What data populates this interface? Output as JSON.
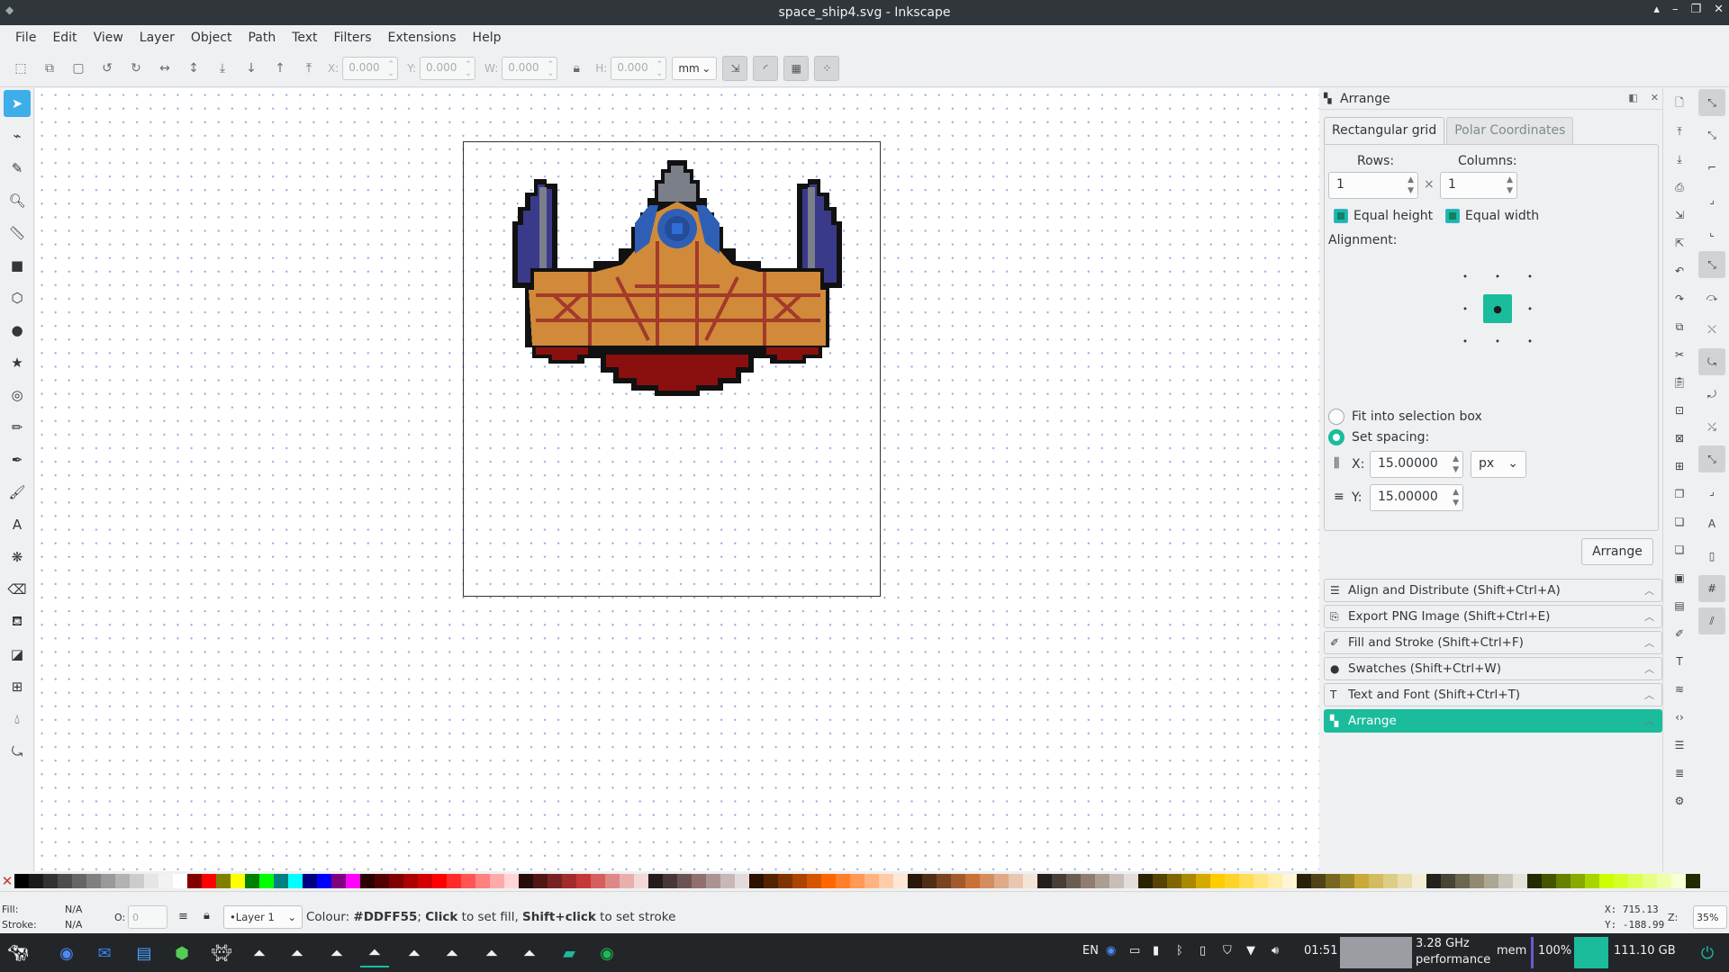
{
  "window": {
    "title": "space_ship4.svg - Inkscape",
    "buttons": [
      "▴",
      "–",
      "❐",
      "✕"
    ]
  },
  "menu": [
    "File",
    "Edit",
    "View",
    "Layer",
    "Object",
    "Path",
    "Text",
    "Filters",
    "Extensions",
    "Help"
  ],
  "toolbar": {
    "x_label": "X:",
    "x_value": "0.000",
    "y_label": "Y:",
    "y_value": "0.000",
    "w_label": "W:",
    "w_value": "0.000",
    "h_label": "H:",
    "h_value": "0.000",
    "unit": "mm"
  },
  "dock": {
    "title": "Arrange",
    "tabs": [
      "Rectangular grid",
      "Polar Coordinates"
    ],
    "rows_label": "Rows:",
    "rows_value": "1",
    "times": "×",
    "columns_label": "Columns:",
    "columns_value": "1",
    "equal_height": "Equal height",
    "equal_width": "Equal width",
    "alignment_label": "Alignment:",
    "fit_label": "Fit into selection box",
    "spacing_label": "Set spacing:",
    "x_label": "X:",
    "x_value": "15.00000",
    "y_label": "Y:",
    "y_value": "15.00000",
    "spacing_unit": "px",
    "arrange_button": "Arrange",
    "panels": [
      "Align and Distribute (Shift+Ctrl+A)",
      "Export PNG Image (Shift+Ctrl+E)",
      "Fill and Stroke (Shift+Ctrl+F)",
      "Swatches (Shift+Ctrl+W)",
      "Text and Font (Shift+Ctrl+T)",
      "Arrange"
    ]
  },
  "status": {
    "fill_label": "Fill:",
    "fill_value": "N/A",
    "stroke_label": "Stroke:",
    "stroke_value": "N/A",
    "opacity_label": "O:",
    "opacity_value": "0",
    "layer": "•Layer 1",
    "message_prefix": "Colour: ",
    "message_color": "#DDFF55",
    "message_sep": "; ",
    "message_click": "Click",
    "message_mid": " to set fill, ",
    "message_shift": "Shift+click",
    "message_end": " to set stroke",
    "x_coord": "X:  715.13",
    "y_coord": "Y: -188.99",
    "zoom_label": "Z:",
    "zoom_value": "35%"
  },
  "taskbar": {
    "lang": "EN",
    "time": "01:51",
    "cpu": "3.28 GHz",
    "cpu_mode": "performance",
    "mem": "mem",
    "battery": "100%",
    "disk": "111.10 GB"
  },
  "colors": {
    "accent": "#1abc9c",
    "selection": "#3daee9",
    "hull": "#d08a3a",
    "hull_line": "#a33a2a",
    "cockpit": "#2f5fb5",
    "wing_blue": "#3a3a8a",
    "nose_grey": "#7a7f8a",
    "exhaust": "#8a1010"
  },
  "palette": [
    "#000000",
    "#1a1a1a",
    "#333333",
    "#4d4d4d",
    "#666666",
    "#808080",
    "#999999",
    "#b3b3b3",
    "#cccccc",
    "#e6e6e6",
    "#f2f2f2",
    "#ffffff",
    "#800000",
    "#ff0000",
    "#808000",
    "#ffff00",
    "#008000",
    "#00ff00",
    "#008080",
    "#00ffff",
    "#000080",
    "#0000ff",
    "#800080",
    "#ff00ff",
    "#2b0000",
    "#550000",
    "#800000",
    "#aa0000",
    "#d40000",
    "#ff0000",
    "#ff2a2a",
    "#ff5555",
    "#ff8080",
    "#ffaaaa",
    "#ffd5d5",
    "#280b0b",
    "#501616",
    "#782121",
    "#a02c2c",
    "#c83737",
    "#d35f5f",
    "#de8787",
    "#e9afaf",
    "#f4d7d7",
    "#241c1c",
    "#483737",
    "#6c5353",
    "#916f6f",
    "#ac9393",
    "#c8b7b7",
    "#e3dbdb",
    "#2b1100",
    "#552200",
    "#803300",
    "#aa4400",
    "#d45500",
    "#ff6600",
    "#ff7f2a",
    "#ff9955",
    "#ffb380",
    "#ffccaa",
    "#ffe6d5",
    "#28170b",
    "#502d16",
    "#784421",
    "#a05a2c",
    "#c87137",
    "#d38d5f",
    "#deaa87",
    "#e9c6af",
    "#f4e3d7",
    "#241f1c",
    "#483e37",
    "#6c5d53",
    "#917c6f",
    "#ac9d93",
    "#c8beb7",
    "#e3dedb",
    "#2b2200",
    "#554400",
    "#806600",
    "#aa8800",
    "#d4aa00",
    "#ffcc00",
    "#ffd42a",
    "#ffdd55",
    "#ffe680",
    "#ffeeaa",
    "#fff6d5",
    "#28220b",
    "#504416",
    "#786721",
    "#a0892c",
    "#c8ab37",
    "#d3bc5f",
    "#decd87",
    "#e9ddaf",
    "#f4eed7",
    "#24221c",
    "#484537",
    "#6c6753",
    "#918a6f",
    "#aca793",
    "#c8c4b7",
    "#e3e2db",
    "#222b00",
    "#445500",
    "#668000",
    "#88aa00",
    "#aad400",
    "#ccff00",
    "#d4ff2a",
    "#ddff55",
    "#e5ff80",
    "#eeffaa",
    "#f6ffd5",
    "#222b00"
  ]
}
